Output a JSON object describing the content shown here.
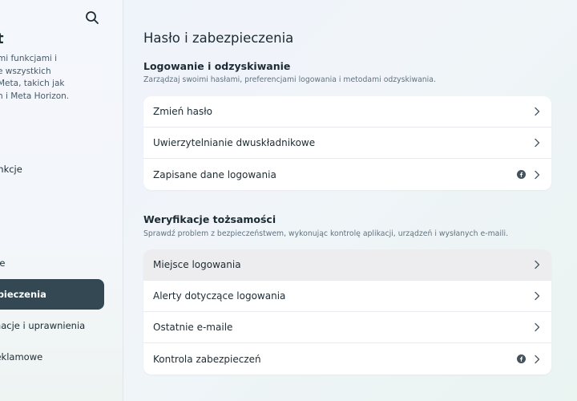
{
  "sidebar": {
    "title": "t",
    "description_lines": [
      "mi funkcjami i",
      "e wszystkich",
      "Meta, takich jak",
      "n i Meta Horizon."
    ],
    "items": [
      {
        "label": "unkcje"
      },
      {
        "label": "we"
      },
      {
        "label": "zpieczenia",
        "active": true
      },
      {
        "label": "macje i uprawnienia"
      },
      {
        "label": "reklamowe"
      }
    ]
  },
  "page": {
    "title": "Hasło i zabezpieczenia"
  },
  "sections": [
    {
      "title": "Logowanie i odzyskiwanie",
      "description": "Zarządzaj swoimi hasłami, preferencjami logowania i metodami odzyskiwania.",
      "rows": [
        {
          "label": "Zmień hasło"
        },
        {
          "label": "Uwierzytelnianie dwuskładnikowe"
        },
        {
          "label": "Zapisane dane logowania",
          "icon": "facebook-icon"
        }
      ]
    },
    {
      "title": "Weryfikacje tożsamości",
      "description": "Sprawdź problem z bezpieczeństwem, wykonując kontrolę aplikacji, urządzeń i wysłanych e-maili.",
      "rows": [
        {
          "label": "Miejsce logowania"
        },
        {
          "label": "Alerty dotyczące logowania"
        },
        {
          "label": "Ostatnie e-maile"
        },
        {
          "label": "Kontrola zabezpieczeń",
          "icon": "facebook-icon"
        }
      ]
    }
  ],
  "icons": {
    "search": "search-icon",
    "chevron": "chevron-right-icon",
    "brand": "facebook-icon"
  },
  "colors": {
    "active_item_bg": "#344854",
    "card_bg": "#ffffff",
    "hover_row_bg": "#ededef",
    "text": "#1c2b33"
  }
}
